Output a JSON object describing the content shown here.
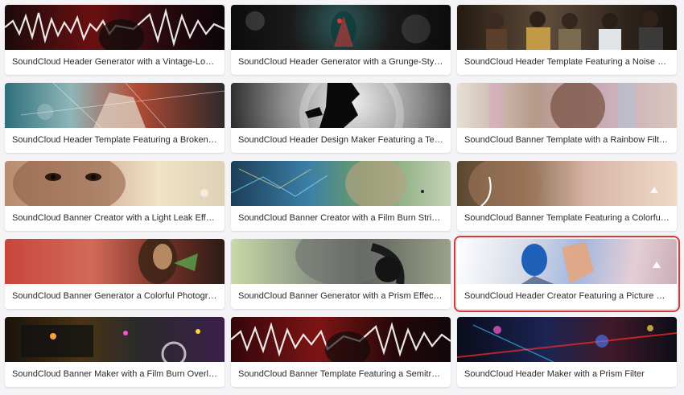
{
  "cards": [
    {
      "title": "SoundCloud Header Generator with a Vintage-Loo...",
      "image": "red vintage waveform with silhouette"
    },
    {
      "title": "SoundCloud Header Generator with a Grunge-Style...",
      "image": "grunge splatter with neon figure"
    },
    {
      "title": "SoundCloud Header Template Featuring a Noise Fil...",
      "image": "group of five men"
    },
    {
      "title": "SoundCloud Header Template Featuring a Broken ...",
      "image": "broken glass hand"
    },
    {
      "title": "SoundCloud Header Design Maker Featuring a Text...",
      "image": "silhouette profile on textured circle"
    },
    {
      "title": "SoundCloud Banner Template with a Rainbow Filte...",
      "image": "woman with rainbow filter"
    },
    {
      "title": "SoundCloud Banner Creator with a Light Leak Effec...",
      "image": "woman with light leak"
    },
    {
      "title": "SoundCloud Banner Creator with a Film Burn Strip...",
      "image": "man with headphones film burn"
    },
    {
      "title": "SoundCloud Banner Template Featuring a Colorful ...",
      "image": "man with earbuds colorful"
    },
    {
      "title": "SoundCloud Banner Generator a Colorful Photogra...",
      "image": "woman colorful photograph"
    },
    {
      "title": "SoundCloud Banner Generator with a Prism Effect ...",
      "image": "man with headphones prism"
    },
    {
      "title": "SoundCloud Header Creator Featuring a Picture of ...",
      "image": "person with cap pastel sky"
    },
    {
      "title": "SoundCloud Banner Maker with a Film Burn Overla...",
      "image": "dj turntable film burn"
    },
    {
      "title": "SoundCloud Banner Template Featuring a Semitra...",
      "image": "red waveform semitransparent"
    },
    {
      "title": "SoundCloud Header Maker with a Prism Filter",
      "image": "concert lights prism"
    }
  ],
  "selected_index": 11,
  "colors": {
    "selection": "#d63a3a",
    "background": "#f4f4f6"
  }
}
